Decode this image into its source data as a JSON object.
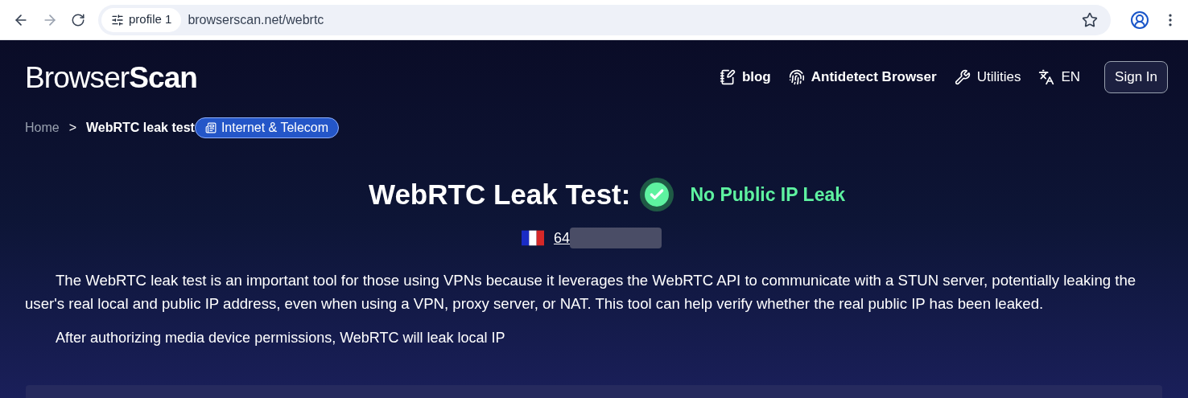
{
  "browser": {
    "profile": "profile 1",
    "url": "browserscan.net/webrtc"
  },
  "logo": {
    "light": "Browser",
    "bold": "Scan"
  },
  "nav": [
    {
      "label": "blog",
      "kind": "blog"
    },
    {
      "label": "Antidetect Browser",
      "kind": "fingerprint"
    },
    {
      "label": "Utilities",
      "kind": "wrench"
    },
    {
      "label": "EN",
      "kind": "language"
    }
  ],
  "sign_in": "Sign In",
  "breadcrumb": {
    "home": "Home",
    "separator": ">",
    "current": "WebRTC leak test",
    "tag": "Internet & Telecom"
  },
  "title": "WebRTC Leak Test:",
  "status": {
    "kind": "ok",
    "text": "No Public IP Leak"
  },
  "ip": {
    "visible": "64"
  },
  "paragraphs": [
    "The WebRTC leak test is an important tool for those using VPNs because it leverages the WebRTC API to communicate with a STUN server, potentially leaking the user's real local and public IP address, even when using a VPN, proxy server, or NAT. This tool can help verify whether the real public IP has been leaked.",
    "After authorizing media device permissions, WebRTC will leak local IP"
  ]
}
